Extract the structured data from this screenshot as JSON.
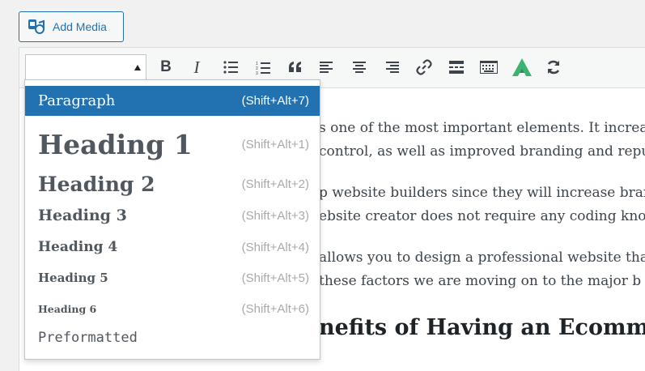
{
  "add_media": {
    "label": "Add Media",
    "icon": "add-media-icon"
  },
  "toolbar": {
    "format_select_value": "",
    "buttons": [
      {
        "name": "bold-button",
        "icon": "bold-icon",
        "glyph": "B"
      },
      {
        "name": "italic-button",
        "icon": "italic-icon",
        "glyph": "I"
      },
      {
        "name": "bulleted-list-button",
        "icon": "bulleted-list-icon"
      },
      {
        "name": "numbered-list-button",
        "icon": "numbered-list-icon"
      },
      {
        "name": "blockquote-button",
        "icon": "quote-icon"
      },
      {
        "name": "align-left-button",
        "icon": "align-left-icon"
      },
      {
        "name": "align-center-button",
        "icon": "align-center-icon"
      },
      {
        "name": "align-right-button",
        "icon": "align-right-icon"
      },
      {
        "name": "insert-link-button",
        "icon": "link-icon"
      },
      {
        "name": "read-more-button",
        "icon": "read-more-icon"
      },
      {
        "name": "toolbar-toggle-button",
        "icon": "keyboard-icon"
      },
      {
        "name": "plugin-button",
        "icon": "green-a-logo-icon"
      },
      {
        "name": "refresh-button",
        "icon": "refresh-icon"
      }
    ]
  },
  "format_dropdown": {
    "items": [
      {
        "label": "Paragraph",
        "shortcut": "(Shift+Alt+7)",
        "selected": true
      },
      {
        "label": "Heading 1",
        "shortcut": "(Shift+Alt+1)"
      },
      {
        "label": "Heading 2",
        "shortcut": "(Shift+Alt+2)"
      },
      {
        "label": "Heading 3",
        "shortcut": "(Shift+Alt+3)"
      },
      {
        "label": "Heading 4",
        "shortcut": "(Shift+Alt+4)"
      },
      {
        "label": "Heading 5",
        "shortcut": "(Shift+Alt+5)"
      },
      {
        "label": "Heading 6",
        "shortcut": "(Shift+Alt+6)"
      },
      {
        "label": "Preformatted",
        "shortcut": ""
      }
    ]
  },
  "content": {
    "lines": [
      "s one of the most important elements. It increa",
      "control, as well as improved branding and repu",
      "p website builders since they will increase bran",
      "ebsite creator does not require any coding know",
      "allows you to design a professional website tha",
      " these factors we are moving on to the major b"
    ],
    "heading": "nefits of Having an Ecomm"
  },
  "colors": {
    "accent": "#2271b1",
    "toolbar_bg": "#f6f7f7",
    "logo_green": "#3cb371"
  }
}
